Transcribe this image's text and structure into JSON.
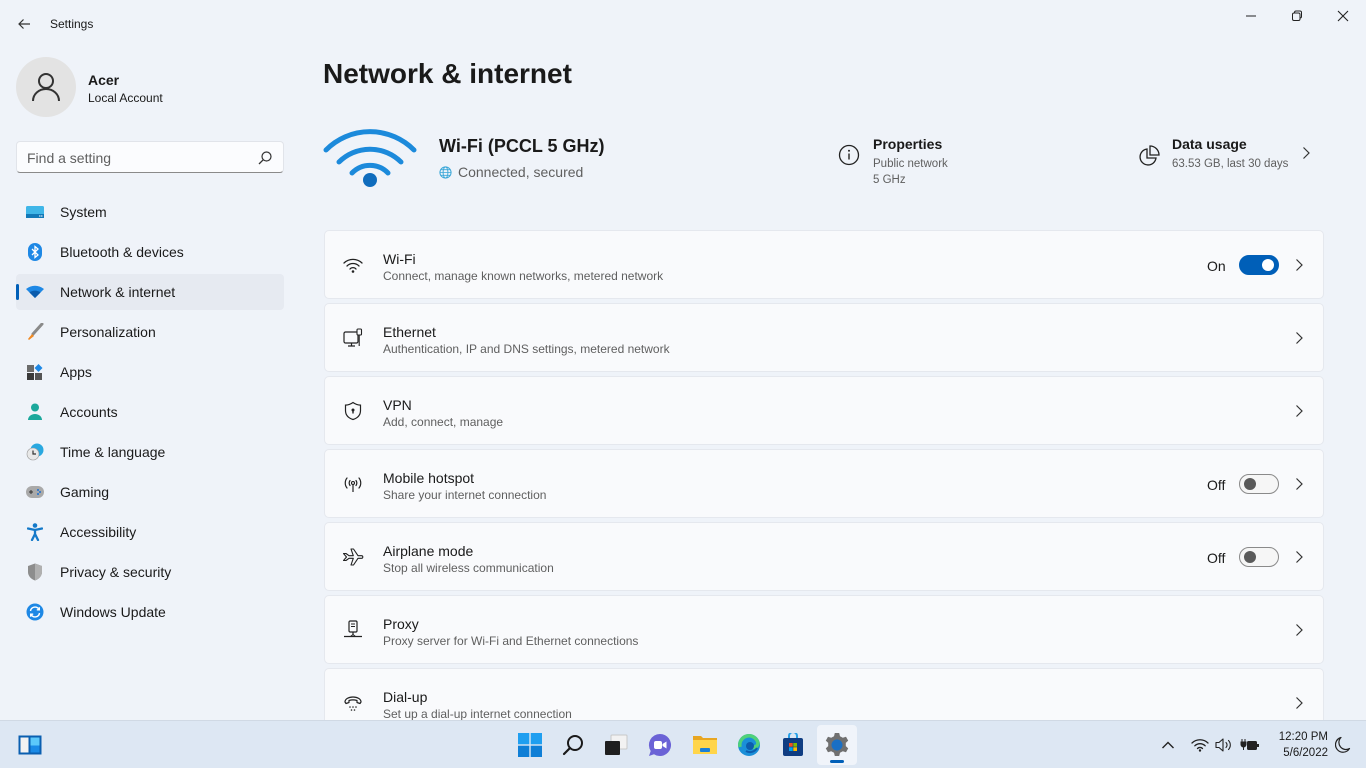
{
  "app": {
    "title": "Settings"
  },
  "window_controls": {
    "minimize": "minimize",
    "maximize": "maximize",
    "close": "close"
  },
  "user": {
    "name": "Acer",
    "account_type": "Local Account"
  },
  "search": {
    "placeholder": "Find a setting",
    "value": ""
  },
  "sidebar": {
    "active": "Network & internet",
    "items": [
      {
        "label": "System",
        "icon": "system-icon"
      },
      {
        "label": "Bluetooth & devices",
        "icon": "bluetooth-icon"
      },
      {
        "label": "Network & internet",
        "icon": "wifi-icon"
      },
      {
        "label": "Personalization",
        "icon": "brush-icon"
      },
      {
        "label": "Apps",
        "icon": "apps-icon"
      },
      {
        "label": "Accounts",
        "icon": "person-icon"
      },
      {
        "label": "Time & language",
        "icon": "clock-globe-icon"
      },
      {
        "label": "Gaming",
        "icon": "gamepad-icon"
      },
      {
        "label": "Accessibility",
        "icon": "accessibility-icon"
      },
      {
        "label": "Privacy & security",
        "icon": "shield-icon"
      },
      {
        "label": "Windows Update",
        "icon": "update-icon"
      }
    ]
  },
  "page": {
    "title": "Network & internet",
    "connection": {
      "name": "Wi-Fi (PCCL 5 GHz)",
      "status": "Connected, secured"
    },
    "properties": {
      "title": "Properties",
      "network_type": "Public network",
      "band": "5 GHz"
    },
    "data_usage": {
      "title": "Data usage",
      "summary": "63.53 GB, last 30 days"
    },
    "cards": [
      {
        "title": "Wi-Fi",
        "subtitle": "Connect, manage known networks, metered network",
        "icon": "wifi-icon",
        "toggle": true,
        "state": "On"
      },
      {
        "title": "Ethernet",
        "subtitle": "Authentication, IP and DNS settings, metered network",
        "icon": "ethernet-icon"
      },
      {
        "title": "VPN",
        "subtitle": "Add, connect, manage",
        "icon": "vpn-shield-icon"
      },
      {
        "title": "Mobile hotspot",
        "subtitle": "Share your internet connection",
        "icon": "hotspot-icon",
        "toggle": false,
        "state": "Off"
      },
      {
        "title": "Airplane mode",
        "subtitle": "Stop all wireless communication",
        "icon": "airplane-icon",
        "toggle": false,
        "state": "Off"
      },
      {
        "title": "Proxy",
        "subtitle": "Proxy server for Wi-Fi and Ethernet connections",
        "icon": "proxy-icon"
      },
      {
        "title": "Dial-up",
        "subtitle": "Set up a dial-up internet connection",
        "icon": "dialup-icon"
      }
    ]
  },
  "taskbar": {
    "apps": [
      "Widgets",
      "Start",
      "Search",
      "Task View",
      "Chat",
      "File Explorer",
      "Microsoft Edge",
      "Microsoft Store",
      "Settings"
    ],
    "active_app": "Settings",
    "clock": {
      "time": "12:20 PM",
      "date": "5/6/2022"
    }
  },
  "colors": {
    "accent": "#005fb8",
    "background": "#eff3f9",
    "card": "#f9fafc"
  }
}
